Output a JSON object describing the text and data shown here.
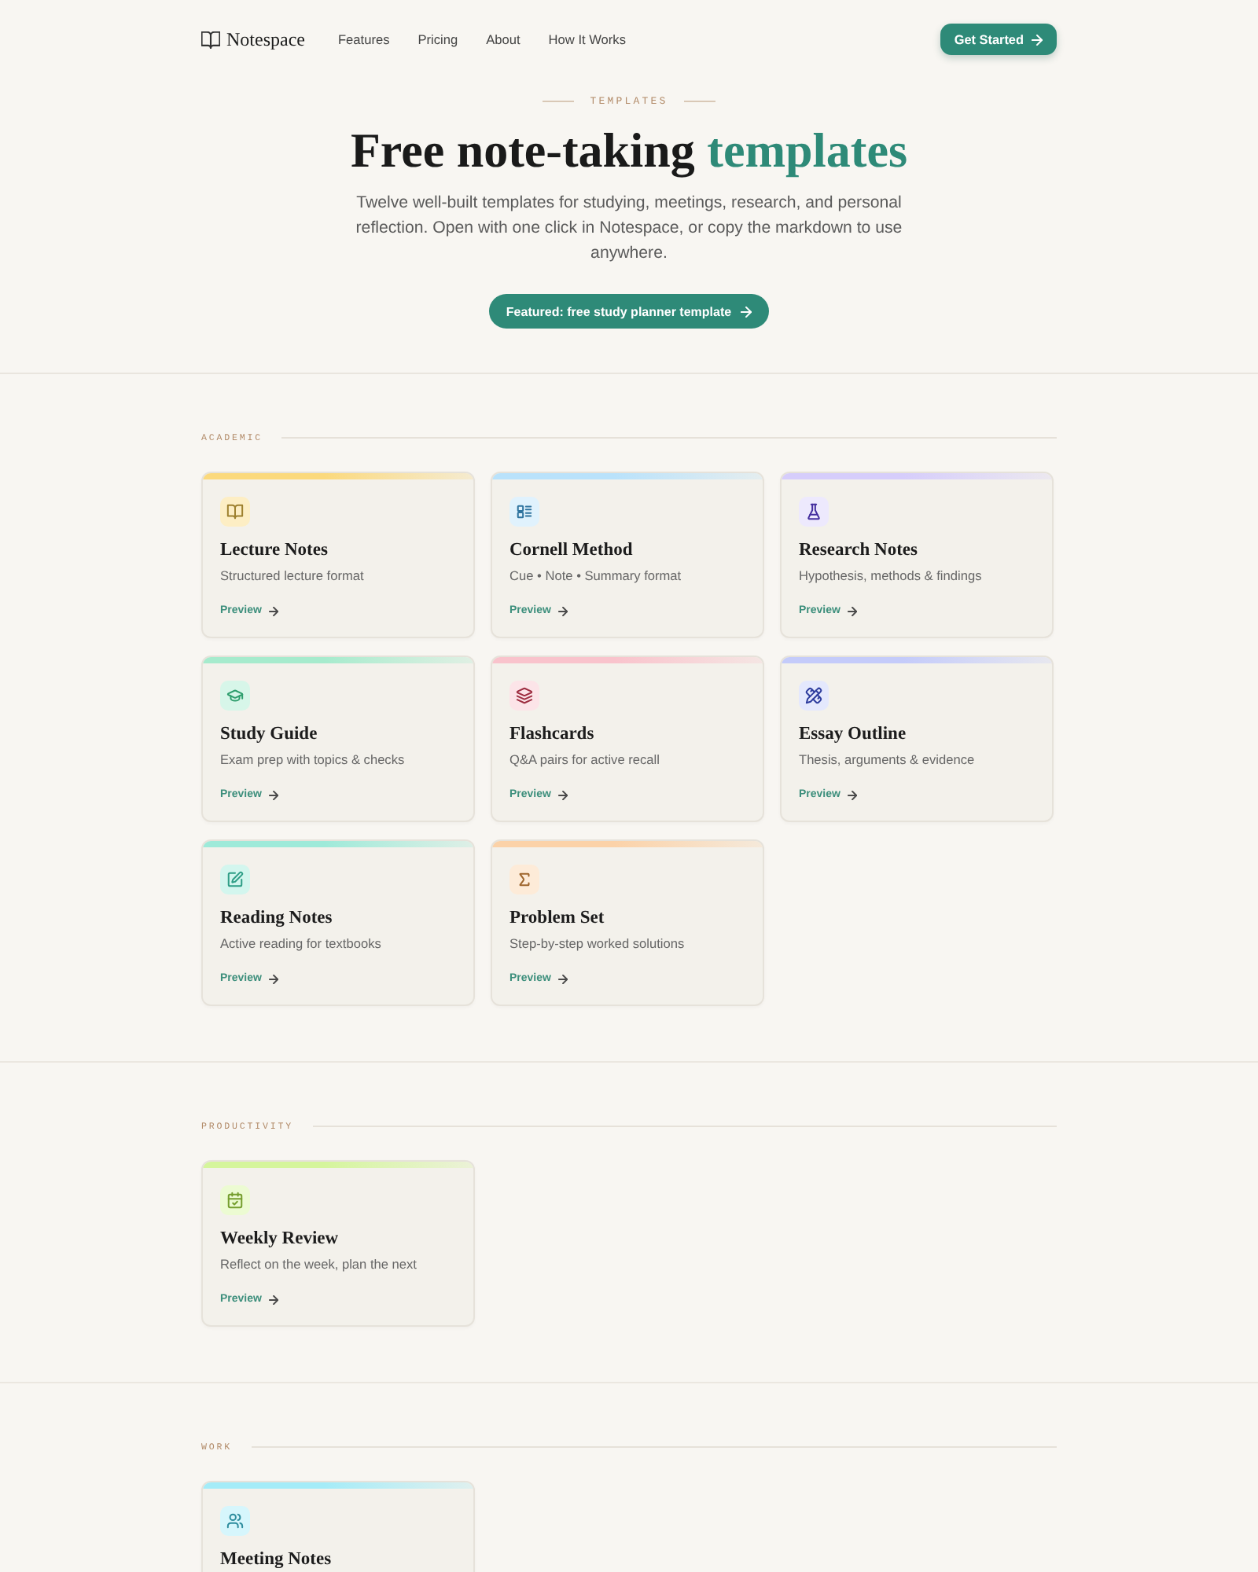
{
  "nav": {
    "brand": "Notespace",
    "links": [
      "Features",
      "Pricing",
      "About",
      "How It Works"
    ],
    "cta": "Get Started"
  },
  "hero": {
    "eyebrow": "TEMPLATES",
    "title": "Free note-taking",
    "title_highlight": "templates",
    "subtitle": "Twelve well-built templates for studying, meetings, research, and personal reflection. Open with one click in Notespace, or copy the markdown to use anywhere.",
    "button": "Featured: free study planner template"
  },
  "sections": [
    {
      "label": "ACADEMIC",
      "cards": [
        {
          "kind": "book",
          "title": "Lecture Notes",
          "description": "Structured lecture format",
          "link": "Preview",
          "color": "#fbd97c"
        },
        {
          "kind": "checklist",
          "title": "Cornell Method",
          "description": "Cue • Note • Summary format",
          "link": "Preview",
          "color": "#b9e2fb"
        },
        {
          "kind": "flask",
          "title": "Research Notes",
          "description": "Hypothesis, methods & findings",
          "link": "Preview",
          "color": "#d6cdfb"
        },
        {
          "kind": "cap",
          "title": "Study Guide",
          "description": "Exam prep with topics & checks",
          "link": "Preview",
          "color": "#a6ebcd"
        },
        {
          "kind": "layers",
          "title": "Flashcards",
          "description": "Q&A pairs for active recall",
          "link": "Preview",
          "color": "#f9c3cc"
        },
        {
          "kind": "pencil",
          "title": "Essay Outline",
          "description": "Thesis, arguments & evidence",
          "link": "Preview",
          "color": "#c4cbfa"
        },
        {
          "kind": "edit",
          "title": "Reading Notes",
          "description": "Active reading for textbooks",
          "link": "Preview",
          "color": "#9eead9"
        },
        {
          "kind": "sigma",
          "title": "Problem Set",
          "description": "Step-by-step worked solutions",
          "link": "Preview",
          "color": "#fbd2a8"
        }
      ]
    },
    {
      "label": "PRODUCTIVITY",
      "cards": [
        {
          "kind": "calendar",
          "title": "Weekly Review",
          "description": "Reflect on the week, plan the next",
          "link": "Preview",
          "color": "#d5f59c"
        }
      ]
    },
    {
      "label": "WORK",
      "cards": [
        {
          "kind": "users",
          "title": "Meeting Notes",
          "color": "#a4ecf8"
        }
      ]
    }
  ]
}
